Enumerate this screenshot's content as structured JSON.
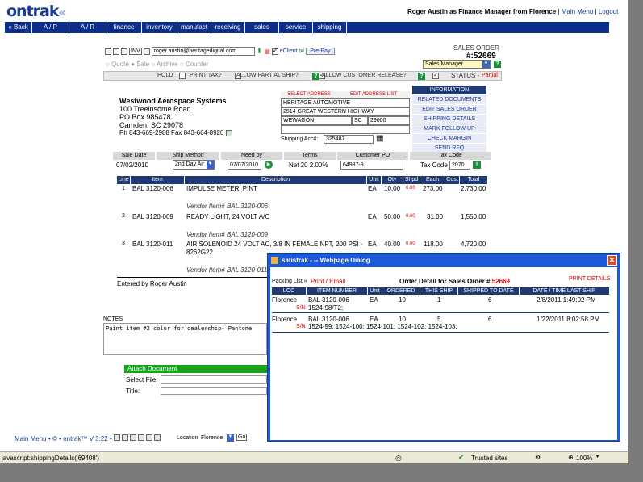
{
  "header": {
    "logo": "ontrak",
    "user_text": "Roger Austin as Finance Manager from Florence",
    "main_menu": "Main Menu",
    "logout": "Logout",
    "sep": "|"
  },
  "nav": [
    "« Back",
    "A / P",
    "A / R",
    "finance",
    "inventory",
    "manufact",
    "receiving",
    "sales",
    "service",
    "shipping"
  ],
  "toolbar": {
    "inv": "INV",
    "email": "roger.austin@heritagedigital.com",
    "eclient": "eClient",
    "prepay": "Pre-Pay",
    "sales_order_label": "SALES ORDER",
    "order_no": "#:52669",
    "role_select": "Sales Manager"
  },
  "mode_radios": [
    "Quote",
    "Sale",
    "Archive",
    "Counter"
  ],
  "options": {
    "hold": "HOLD",
    "print_tax": "PRINT TAX?",
    "partial_ship": "ALLOW PARTIAL SHIP?",
    "customer_release": "ALLOW CUSTOMER RELEASE?",
    "status_label": "STATUS -",
    "status_value": "Partial"
  },
  "customer": {
    "name": "Westwood Aerospace Systems",
    "addr1": "100 Treeinsome Road",
    "addr2": "PO Box 985478",
    "city": "Camden, SC 29078",
    "phone": "Ph 843-669-2988  Fax 843-664-8920"
  },
  "shipping": {
    "select_address": "SELECT ADDRESS",
    "edit_address_list": "EDIT ADDRESS LIST",
    "name": "HERITAGE AUTOMOTIVE",
    "street": "2514 GREAT WESTERN HIGHWAY",
    "city": "WEWAGON",
    "state": "SC",
    "zip": "29000",
    "acct_label": "Shipping Acc#:",
    "acct": "325487"
  },
  "side_buttons": [
    "INFORMATION",
    "RELATED DOCUMENTS",
    "EDIT SALES ORDER",
    "SHIPPING DETAILS",
    "MARK FOLLOW UP",
    "CHECK MARGIN",
    "SEND RFQ"
  ],
  "order_info": {
    "headers": [
      "Sale Date",
      "Ship Method",
      "Need by",
      "Terms",
      "Customer PO",
      "Tax Code"
    ],
    "sale_date": "07/02/2010",
    "ship_method": "2nd Day Air",
    "need_by": "07/07/2010",
    "terms": "Net 20 2.00%",
    "customer_po": "64987-9",
    "tax_code_label": "Tax Code",
    "tax_code": "2070"
  },
  "line_headers": [
    "Line",
    "Item",
    "Description",
    "Unit",
    "Qty",
    "Shpd",
    "Each",
    "Cost",
    "Total"
  ],
  "lines": [
    {
      "line": "1",
      "item": "BAL 3120-006",
      "desc": "IMPULSE METER, PINT",
      "desc2": "",
      "unit": "EA",
      "qty": "10.00",
      "shpd": "6.00",
      "each": "273.00",
      "total": "2,730.00",
      "vendor": "Vendor Item# BAL 3120-006"
    },
    {
      "line": "2",
      "item": "BAL 3120-009",
      "desc": "READY LIGHT, 24 VOLT A/C",
      "desc2": "",
      "unit": "EA",
      "qty": "50.00",
      "shpd": "0.00",
      "each": "31.00",
      "total": "1,550.00",
      "vendor": "Vendor Item# BAL 3120-009"
    },
    {
      "line": "3",
      "item": "BAL 3120-011",
      "desc": "AIR SOLENOID 24 VOLT AC, 3/8 IN FEMALE NPT, 200 PSI -",
      "desc2": "8262G22",
      "unit": "EA",
      "qty": "40.00",
      "shpd": "0.00",
      "each": "118.00",
      "total": "4,720.00",
      "vendor": "Vendor Item# BAL 3120-011"
    }
  ],
  "entered_by": "Entered by Roger Austin",
  "notes": {
    "label": "NOTES",
    "text": "Paint item #2 color for dealership- Pantone"
  },
  "attach": {
    "title": "Attach Document",
    "select_file": "Select File:",
    "title_label": "Title:"
  },
  "footer": {
    "main_menu": "Main Menu",
    "version": "• © • ontrak™ V 3.22 •",
    "location_label": "Location",
    "location": "Florence",
    "go": "Go"
  },
  "statusbar": {
    "url": "javascript:shippingDetails('69408')",
    "zone": "Trusted sites",
    "zoom": "100%"
  },
  "dialog": {
    "title": "satistrak - -- Webpage Dialog",
    "packing_list": "Packing List »",
    "print_email": "Print / Email",
    "heading": "Order Detail for Sales Order #",
    "order_no": "52669",
    "print_details": "PRINT DETAILS",
    "headers": [
      "LOC",
      "ITEM NUMBER",
      "Unit",
      "ORDERED",
      "THIS SHIP",
      "SHIPPED TO DATE",
      "DATE / TIME LAST SHIP"
    ],
    "rows": [
      {
        "loc": "Florence",
        "item": "BAL 3120-006",
        "unit": "EA",
        "ordered": "10",
        "this_ship": "1",
        "shipped": "6",
        "date": "2/8/2011 1:49:02 PM",
        "sn_label": "S/N",
        "sn": "1524-98/T2;"
      },
      {
        "loc": "Florence",
        "item": "BAL 3120-006",
        "unit": "EA",
        "ordered": "10",
        "this_ship": "5",
        "shipped": "6",
        "date": "1/22/2011 8:02:58 PM",
        "sn_label": "S/N",
        "sn": "1524-99;  1524-100;  1524-101;  1524-102;  1524-103;"
      }
    ]
  }
}
